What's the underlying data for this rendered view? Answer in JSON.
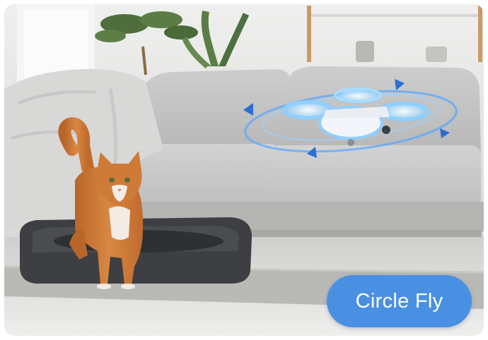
{
  "badge": {
    "label": "Circle Fly",
    "color": "#4a90e2"
  },
  "scene": {
    "subjects": [
      "orange-tabby-cat",
      "toy-quadcopter-drone",
      "grey-sofa",
      "dark-pet-bed",
      "potted-plant",
      "shaggy-rug"
    ],
    "drone_lights_color": "#8fd0ff",
    "orbit_arrow_color": "#2a6fd1"
  }
}
